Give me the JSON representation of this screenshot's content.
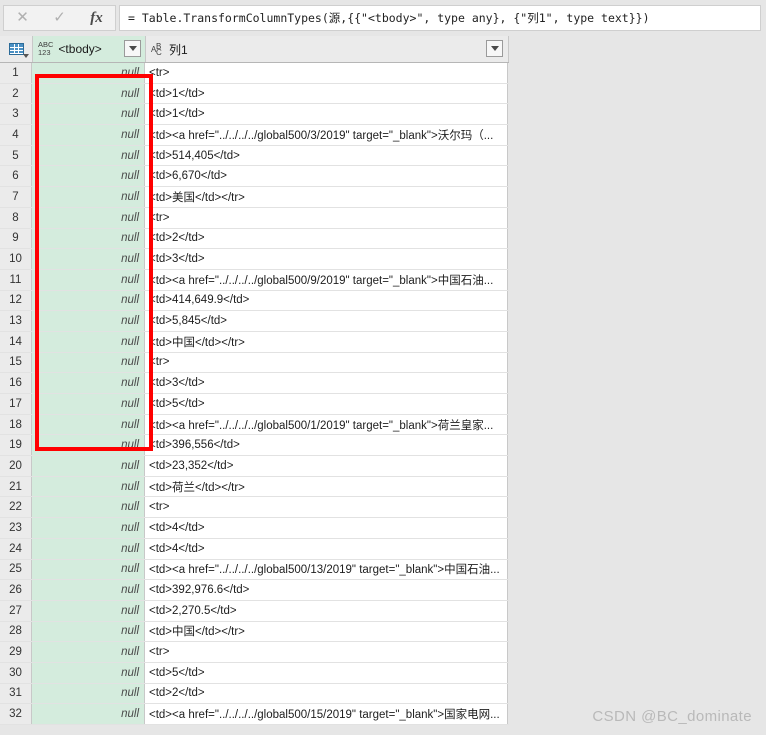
{
  "formula_bar": {
    "cancel_label": "✕",
    "accept_label": "✓",
    "fx_label": "fx",
    "formula": "= Table.TransformColumnTypes(源,{{\"<tbody>\", type any}, {\"列1\", type text}})"
  },
  "grid": {
    "corner_icon": "table-select-all-icon",
    "columns": [
      {
        "name": "<tbody>",
        "type_icon": "ABC\n123",
        "type_icon_name": "any-type-icon"
      },
      {
        "name": "列1",
        "type_icon": "ABC",
        "type_icon_name": "text-type-icon"
      }
    ],
    "rows": [
      {
        "num": "1",
        "tbody": "null",
        "lie1": "<tr>"
      },
      {
        "num": "2",
        "tbody": "null",
        "lie1": "<td>1</td>"
      },
      {
        "num": "3",
        "tbody": "null",
        "lie1": "<td>1</td>"
      },
      {
        "num": "4",
        "tbody": "null",
        "lie1": "<td><a href=\"../../../../global500/3/2019\" target=\"_blank\">沃尔玛（..."
      },
      {
        "num": "5",
        "tbody": "null",
        "lie1": "<td>514,405</td>"
      },
      {
        "num": "6",
        "tbody": "null",
        "lie1": "<td>6,670</td>"
      },
      {
        "num": "7",
        "tbody": "null",
        "lie1": "<td>美国</td></tr>"
      },
      {
        "num": "8",
        "tbody": "null",
        "lie1": "<tr>"
      },
      {
        "num": "9",
        "tbody": "null",
        "lie1": "<td>2</td>"
      },
      {
        "num": "10",
        "tbody": "null",
        "lie1": "<td>3</td>"
      },
      {
        "num": "11",
        "tbody": "null",
        "lie1": "<td><a href=\"../../../../global500/9/2019\" target=\"_blank\">中国石油..."
      },
      {
        "num": "12",
        "tbody": "null",
        "lie1": "<td>414,649.9</td>"
      },
      {
        "num": "13",
        "tbody": "null",
        "lie1": "<td>5,845</td>"
      },
      {
        "num": "14",
        "tbody": "null",
        "lie1": "<td>中国</td></tr>"
      },
      {
        "num": "15",
        "tbody": "null",
        "lie1": "<tr>"
      },
      {
        "num": "16",
        "tbody": "null",
        "lie1": "<td>3</td>"
      },
      {
        "num": "17",
        "tbody": "null",
        "lie1": "<td>5</td>"
      },
      {
        "num": "18",
        "tbody": "null",
        "lie1": "<td><a href=\"../../../../global500/1/2019\" target=\"_blank\">荷兰皇家..."
      },
      {
        "num": "19",
        "tbody": "null",
        "lie1": "<td>396,556</td>"
      },
      {
        "num": "20",
        "tbody": "null",
        "lie1": "<td>23,352</td>"
      },
      {
        "num": "21",
        "tbody": "null",
        "lie1": "<td>荷兰</td></tr>"
      },
      {
        "num": "22",
        "tbody": "null",
        "lie1": "<tr>"
      },
      {
        "num": "23",
        "tbody": "null",
        "lie1": "<td>4</td>"
      },
      {
        "num": "24",
        "tbody": "null",
        "lie1": "<td>4</td>"
      },
      {
        "num": "25",
        "tbody": "null",
        "lie1": "<td><a href=\"../../../../global500/13/2019\" target=\"_blank\">中国石油..."
      },
      {
        "num": "26",
        "tbody": "null",
        "lie1": "<td>392,976.6</td>"
      },
      {
        "num": "27",
        "tbody": "null",
        "lie1": "<td>2,270.5</td>"
      },
      {
        "num": "28",
        "tbody": "null",
        "lie1": "<td>中国</td></tr>"
      },
      {
        "num": "29",
        "tbody": "null",
        "lie1": "<tr>"
      },
      {
        "num": "30",
        "tbody": "null",
        "lie1": "<td>5</td>"
      },
      {
        "num": "31",
        "tbody": "null",
        "lie1": "<td>2</td>"
      },
      {
        "num": "32",
        "tbody": "null",
        "lie1": "<td><a href=\"../../../../global500/15/2019\" target=\"_blank\">国家电网..."
      }
    ]
  },
  "annotation": {
    "color": "#ff0000",
    "name": "red-highlight-rectangle"
  },
  "watermark": {
    "text": "CSDN @BC_dominate"
  }
}
